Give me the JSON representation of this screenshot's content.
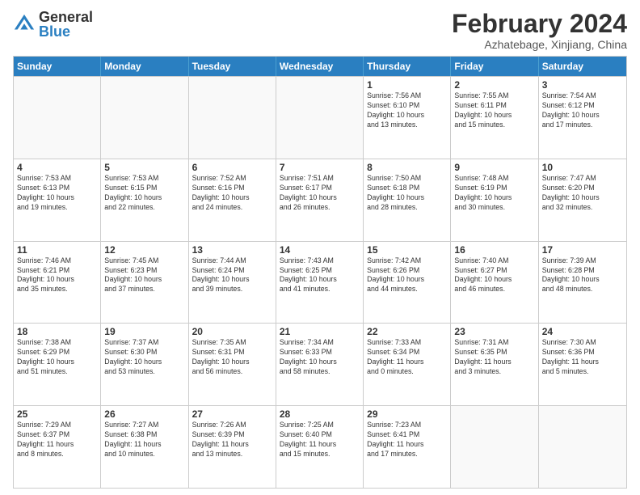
{
  "logo": {
    "general": "General",
    "blue": "Blue"
  },
  "title": "February 2024",
  "subtitle": "Azhatebage, Xinjiang, China",
  "days_of_week": [
    "Sunday",
    "Monday",
    "Tuesday",
    "Wednesday",
    "Thursday",
    "Friday",
    "Saturday"
  ],
  "weeks": [
    [
      {
        "day": "",
        "info": "",
        "empty": true
      },
      {
        "day": "",
        "info": "",
        "empty": true
      },
      {
        "day": "",
        "info": "",
        "empty": true
      },
      {
        "day": "",
        "info": "",
        "empty": true
      },
      {
        "day": "1",
        "info": "Sunrise: 7:56 AM\nSunset: 6:10 PM\nDaylight: 10 hours\nand 13 minutes."
      },
      {
        "day": "2",
        "info": "Sunrise: 7:55 AM\nSunset: 6:11 PM\nDaylight: 10 hours\nand 15 minutes."
      },
      {
        "day": "3",
        "info": "Sunrise: 7:54 AM\nSunset: 6:12 PM\nDaylight: 10 hours\nand 17 minutes."
      }
    ],
    [
      {
        "day": "4",
        "info": "Sunrise: 7:53 AM\nSunset: 6:13 PM\nDaylight: 10 hours\nand 19 minutes."
      },
      {
        "day": "5",
        "info": "Sunrise: 7:53 AM\nSunset: 6:15 PM\nDaylight: 10 hours\nand 22 minutes."
      },
      {
        "day": "6",
        "info": "Sunrise: 7:52 AM\nSunset: 6:16 PM\nDaylight: 10 hours\nand 24 minutes."
      },
      {
        "day": "7",
        "info": "Sunrise: 7:51 AM\nSunset: 6:17 PM\nDaylight: 10 hours\nand 26 minutes."
      },
      {
        "day": "8",
        "info": "Sunrise: 7:50 AM\nSunset: 6:18 PM\nDaylight: 10 hours\nand 28 minutes."
      },
      {
        "day": "9",
        "info": "Sunrise: 7:48 AM\nSunset: 6:19 PM\nDaylight: 10 hours\nand 30 minutes."
      },
      {
        "day": "10",
        "info": "Sunrise: 7:47 AM\nSunset: 6:20 PM\nDaylight: 10 hours\nand 32 minutes."
      }
    ],
    [
      {
        "day": "11",
        "info": "Sunrise: 7:46 AM\nSunset: 6:21 PM\nDaylight: 10 hours\nand 35 minutes."
      },
      {
        "day": "12",
        "info": "Sunrise: 7:45 AM\nSunset: 6:23 PM\nDaylight: 10 hours\nand 37 minutes."
      },
      {
        "day": "13",
        "info": "Sunrise: 7:44 AM\nSunset: 6:24 PM\nDaylight: 10 hours\nand 39 minutes."
      },
      {
        "day": "14",
        "info": "Sunrise: 7:43 AM\nSunset: 6:25 PM\nDaylight: 10 hours\nand 41 minutes."
      },
      {
        "day": "15",
        "info": "Sunrise: 7:42 AM\nSunset: 6:26 PM\nDaylight: 10 hours\nand 44 minutes."
      },
      {
        "day": "16",
        "info": "Sunrise: 7:40 AM\nSunset: 6:27 PM\nDaylight: 10 hours\nand 46 minutes."
      },
      {
        "day": "17",
        "info": "Sunrise: 7:39 AM\nSunset: 6:28 PM\nDaylight: 10 hours\nand 48 minutes."
      }
    ],
    [
      {
        "day": "18",
        "info": "Sunrise: 7:38 AM\nSunset: 6:29 PM\nDaylight: 10 hours\nand 51 minutes."
      },
      {
        "day": "19",
        "info": "Sunrise: 7:37 AM\nSunset: 6:30 PM\nDaylight: 10 hours\nand 53 minutes."
      },
      {
        "day": "20",
        "info": "Sunrise: 7:35 AM\nSunset: 6:31 PM\nDaylight: 10 hours\nand 56 minutes."
      },
      {
        "day": "21",
        "info": "Sunrise: 7:34 AM\nSunset: 6:33 PM\nDaylight: 10 hours\nand 58 minutes."
      },
      {
        "day": "22",
        "info": "Sunrise: 7:33 AM\nSunset: 6:34 PM\nDaylight: 11 hours\nand 0 minutes."
      },
      {
        "day": "23",
        "info": "Sunrise: 7:31 AM\nSunset: 6:35 PM\nDaylight: 11 hours\nand 3 minutes."
      },
      {
        "day": "24",
        "info": "Sunrise: 7:30 AM\nSunset: 6:36 PM\nDaylight: 11 hours\nand 5 minutes."
      }
    ],
    [
      {
        "day": "25",
        "info": "Sunrise: 7:29 AM\nSunset: 6:37 PM\nDaylight: 11 hours\nand 8 minutes."
      },
      {
        "day": "26",
        "info": "Sunrise: 7:27 AM\nSunset: 6:38 PM\nDaylight: 11 hours\nand 10 minutes."
      },
      {
        "day": "27",
        "info": "Sunrise: 7:26 AM\nSunset: 6:39 PM\nDaylight: 11 hours\nand 13 minutes."
      },
      {
        "day": "28",
        "info": "Sunrise: 7:25 AM\nSunset: 6:40 PM\nDaylight: 11 hours\nand 15 minutes."
      },
      {
        "day": "29",
        "info": "Sunrise: 7:23 AM\nSunset: 6:41 PM\nDaylight: 11 hours\nand 17 minutes."
      },
      {
        "day": "",
        "info": "",
        "empty": true
      },
      {
        "day": "",
        "info": "",
        "empty": true
      }
    ]
  ]
}
